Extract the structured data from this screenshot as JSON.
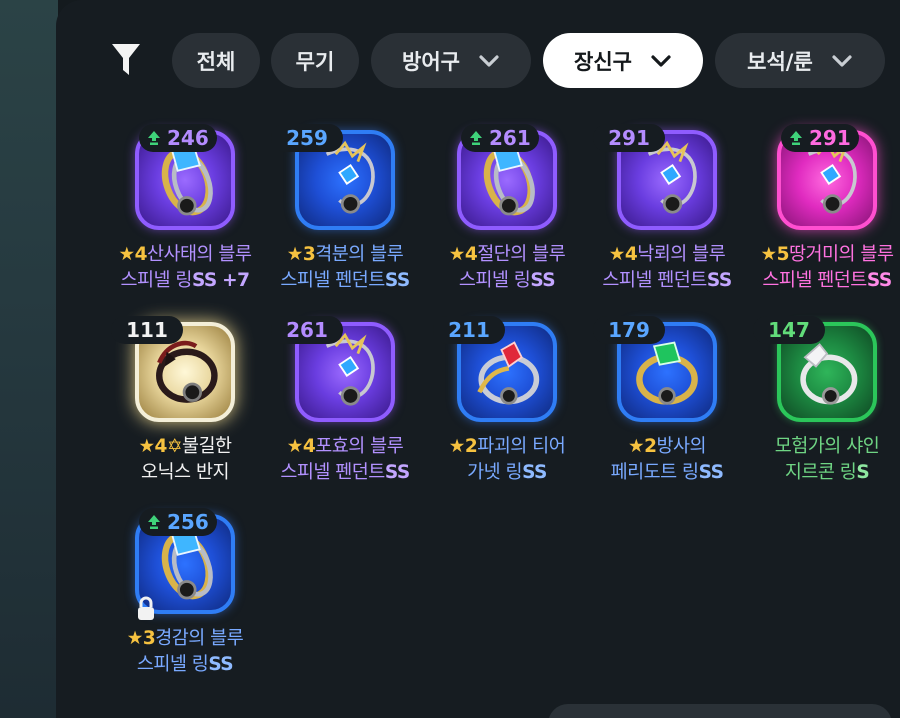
{
  "filter": {
    "icon": "funnel-icon"
  },
  "tabs": [
    {
      "label": "전체",
      "dropdown": false,
      "active": false
    },
    {
      "label": "무기",
      "dropdown": false,
      "active": false
    },
    {
      "label": "방어구",
      "dropdown": true,
      "active": false
    },
    {
      "label": "장신구",
      "dropdown": true,
      "active": true
    },
    {
      "label": "보석/룬",
      "dropdown": true,
      "active": false
    }
  ],
  "items": [
    {
      "level": "246",
      "upgrade": true,
      "color": "purple",
      "art": "ring",
      "stars": "★4",
      "line1": "산사태의 블루",
      "line2": "스피넬 링",
      "suffix": "SS",
      "plus": "+7",
      "locked": false
    },
    {
      "level": "259",
      "upgrade": false,
      "color": "blue",
      "art": "pendant",
      "stars": "★3",
      "line1": "격분의 블루",
      "line2": "스피넬 펜던트",
      "suffix": "SS",
      "plus": "",
      "locked": false
    },
    {
      "level": "261",
      "upgrade": true,
      "color": "purple",
      "art": "ring",
      "stars": "★4",
      "line1": "절단의 블루",
      "line2": "스피넬 링",
      "suffix": "SS",
      "plus": "",
      "locked": false
    },
    {
      "level": "291",
      "upgrade": false,
      "color": "purple",
      "art": "pendant",
      "stars": "★4",
      "line1": "낙뢰의 블루",
      "line2": "스피넬 펜던트",
      "suffix": "SS",
      "plus": "",
      "locked": false
    },
    {
      "level": "291",
      "upgrade": true,
      "color": "pink",
      "art": "pendant",
      "stars": "★5",
      "line1": "땅거미의 블루",
      "line2": "스피넬 펜던트",
      "suffix": "SS",
      "plus": "",
      "locked": false
    },
    {
      "level": "111",
      "upgrade": false,
      "color": "gold",
      "art": "onyx",
      "stars": "★4",
      "gem": "✡",
      "line1": "불길한",
      "line2": "오닉스 반지",
      "suffix": "",
      "plus": "",
      "locked": false
    },
    {
      "level": "261",
      "upgrade": false,
      "color": "purple",
      "art": "pendant",
      "stars": "★4",
      "line1": "포효의 블루",
      "line2": "스피넬 펜던트",
      "suffix": "SS",
      "plus": "",
      "locked": false
    },
    {
      "level": "211",
      "upgrade": false,
      "color": "blue",
      "art": "tierring",
      "stars": "★2",
      "line1": "파괴의 티어",
      "line2": "가넷 링",
      "suffix": "SS",
      "plus": "",
      "locked": false
    },
    {
      "level": "179",
      "upgrade": false,
      "color": "blue",
      "art": "greenring",
      "stars": "★2",
      "line1": "방사의",
      "line2": "페리도트 링",
      "suffix": "SS",
      "plus": "",
      "locked": false
    },
    {
      "level": "147",
      "upgrade": false,
      "color": "green",
      "art": "silver",
      "stars": "",
      "line1": "모험가의 샤인",
      "line2": "지르콘 링",
      "suffix": "S",
      "plus": "",
      "locked": false
    },
    {
      "level": "256",
      "upgrade": true,
      "color": "blue",
      "art": "ring",
      "stars": "★3",
      "line1": "경감의 블루",
      "line2": "스피넬 링",
      "suffix": "SS",
      "plus": "",
      "locked": true
    }
  ],
  "colors": {
    "purple": "#8f5cff",
    "blue": "#2f7df5",
    "pink": "#ff4fd0",
    "green": "#2bc65a",
    "gold": "#f4efd8",
    "star": "#f6c240",
    "upgrade_arrow": "#3fd27a"
  }
}
